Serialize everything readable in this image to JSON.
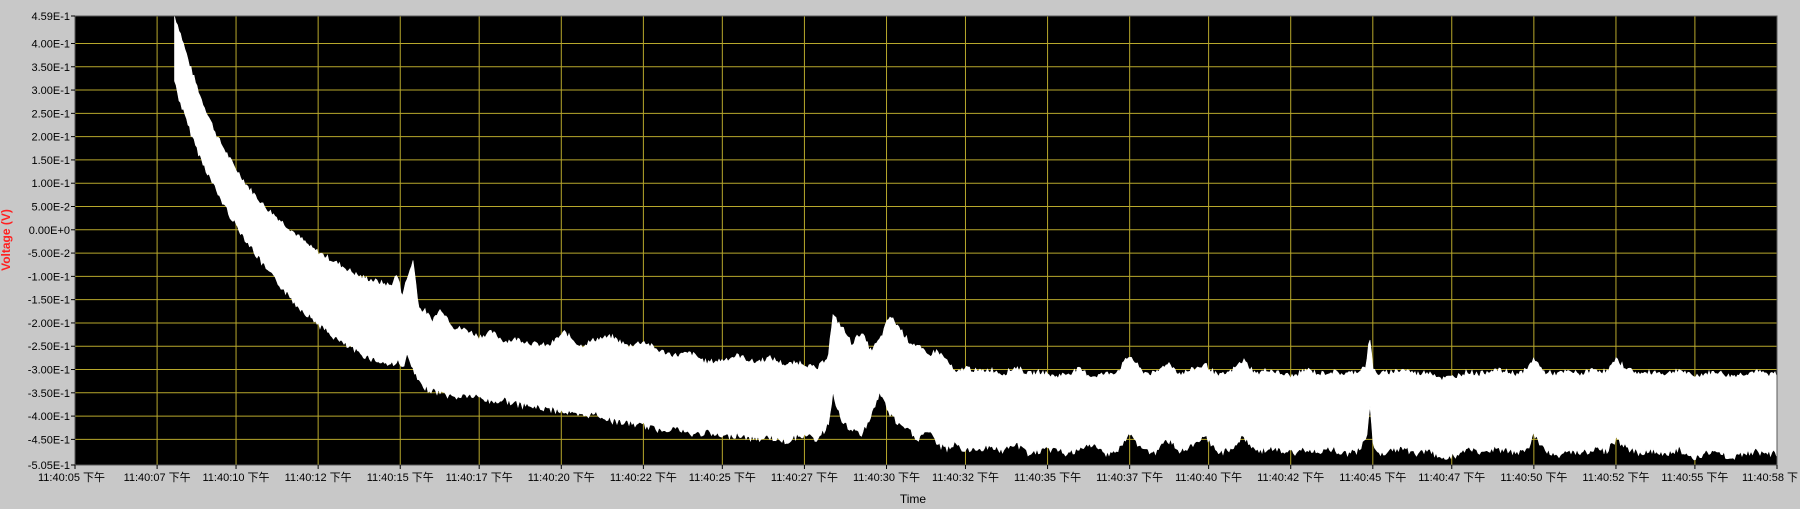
{
  "chart_data": {
    "type": "line",
    "title": "",
    "xlabel": "Time",
    "ylabel": "Voltage (V)",
    "ylim": [
      -0.505,
      0.459
    ],
    "grid": true,
    "colors": {
      "plot_bg": "#000000",
      "grid": "#b8a82c",
      "signal": "#ffffff",
      "frame_bg": "#c8c8c8",
      "ylabel": "#ff2020",
      "tick_text": "#000000"
    },
    "y_ticks": [
      {
        "value": 0.459,
        "label": "4.59E-1"
      },
      {
        "value": 0.4,
        "label": "4.00E-1"
      },
      {
        "value": 0.35,
        "label": "3.50E-1"
      },
      {
        "value": 0.3,
        "label": "3.00E-1"
      },
      {
        "value": 0.25,
        "label": "2.50E-1"
      },
      {
        "value": 0.2,
        "label": "2.00E-1"
      },
      {
        "value": 0.15,
        "label": "1.50E-1"
      },
      {
        "value": 0.1,
        "label": "1.00E-1"
      },
      {
        "value": 0.05,
        "label": "5.00E-2"
      },
      {
        "value": 0.0,
        "label": "0.00E+0"
      },
      {
        "value": -0.05,
        "label": "-5.00E-2"
      },
      {
        "value": -0.1,
        "label": "-1.00E-1"
      },
      {
        "value": -0.15,
        "label": "-1.50E-1"
      },
      {
        "value": -0.2,
        "label": "-2.00E-1"
      },
      {
        "value": -0.25,
        "label": "-2.50E-1"
      },
      {
        "value": -0.3,
        "label": "-3.00E-1"
      },
      {
        "value": -0.35,
        "label": "-3.50E-1"
      },
      {
        "value": -0.4,
        "label": "-4.00E-1"
      },
      {
        "value": -0.45,
        "label": "-4.50E-1"
      },
      {
        "value": -0.505,
        "label": "-5.05E-1"
      }
    ],
    "x_ticks": [
      {
        "t": 0.0,
        "label": "11:40:05 下午"
      },
      {
        "t": 2.6,
        "label": "11:40:07 下午"
      },
      {
        "t": 5.1,
        "label": "11:40:10 下午"
      },
      {
        "t": 7.7,
        "label": "11:40:12 下午"
      },
      {
        "t": 10.3,
        "label": "11:40:15 下午"
      },
      {
        "t": 12.8,
        "label": "11:40:17 下午"
      },
      {
        "t": 15.4,
        "label": "11:40:20 下午"
      },
      {
        "t": 18.0,
        "label": "11:40:22 下午"
      },
      {
        "t": 20.5,
        "label": "11:40:25 下午"
      },
      {
        "t": 23.1,
        "label": "11:40:27 下午"
      },
      {
        "t": 25.7,
        "label": "11:40:30 下午"
      },
      {
        "t": 28.2,
        "label": "11:40:32 下午"
      },
      {
        "t": 30.8,
        "label": "11:40:35 下午"
      },
      {
        "t": 33.4,
        "label": "11:40:37 下午"
      },
      {
        "t": 35.9,
        "label": "11:40:40 下午"
      },
      {
        "t": 38.5,
        "label": "11:40:42 下午"
      },
      {
        "t": 41.1,
        "label": "11:40:45 下午"
      },
      {
        "t": 43.6,
        "label": "11:40:47 下午"
      },
      {
        "t": 46.2,
        "label": "11:40:50 下午"
      },
      {
        "t": 48.8,
        "label": "11:40:52 下午"
      },
      {
        "t": 51.3,
        "label": "11:40:55 下午"
      },
      {
        "t": 53.9,
        "label": "11:40:58 下"
      }
    ],
    "xlim": [
      0,
      53.9
    ],
    "series": [
      {
        "kind": "band",
        "x": [
          3.15,
          3.3,
          3.6,
          4.0,
          4.5,
          5.0,
          5.5,
          6.0,
          6.5,
          7.0,
          7.5,
          8.0,
          8.5,
          9.0,
          9.5,
          10.0,
          10.2,
          10.35,
          10.5,
          10.7,
          10.9,
          11.1,
          11.3,
          11.6,
          12.0,
          12.4,
          12.8,
          13.2,
          13.6,
          14.0,
          14.5,
          15.0,
          15.5,
          16.0,
          16.5,
          17.0,
          17.5,
          18.0,
          18.5,
          19.0,
          19.5,
          20.0,
          20.5,
          21.0,
          21.5,
          22.0,
          22.5,
          23.0,
          23.5,
          23.85,
          24.0,
          24.3,
          24.6,
          24.9,
          25.2,
          25.5,
          25.8,
          26.1,
          26.4,
          26.7,
          27.0,
          27.3,
          27.6,
          27.9,
          28.2,
          28.6,
          29.0,
          29.4,
          29.8,
          30.2,
          30.6,
          31.0,
          31.4,
          31.8,
          32.2,
          32.6,
          33.0,
          33.4,
          33.8,
          34.2,
          34.6,
          35.0,
          35.4,
          35.8,
          36.2,
          36.6,
          37.0,
          37.4,
          37.8,
          38.2,
          38.6,
          39.0,
          39.4,
          39.8,
          40.2,
          40.6,
          40.9,
          41.0,
          41.1,
          41.3,
          41.7,
          42.1,
          42.5,
          42.9,
          43.3,
          43.7,
          44.1,
          44.5,
          44.9,
          45.3,
          45.7,
          46.0,
          46.2,
          46.5,
          46.9,
          47.3,
          47.7,
          48.1,
          48.5,
          48.8,
          49.2,
          49.6,
          50.0,
          50.4,
          50.8,
          51.2,
          51.6,
          52.0,
          52.4,
          52.8,
          53.2,
          53.6,
          53.9
        ],
        "upper": [
          0.459,
          0.43,
          0.36,
          0.28,
          0.2,
          0.14,
          0.09,
          0.05,
          0.02,
          -0.01,
          -0.04,
          -0.06,
          -0.08,
          -0.1,
          -0.11,
          -0.12,
          -0.095,
          -0.14,
          -0.11,
          -0.065,
          -0.17,
          -0.175,
          -0.195,
          -0.17,
          -0.21,
          -0.215,
          -0.23,
          -0.22,
          -0.24,
          -0.235,
          -0.245,
          -0.25,
          -0.22,
          -0.25,
          -0.235,
          -0.23,
          -0.25,
          -0.24,
          -0.26,
          -0.27,
          -0.265,
          -0.285,
          -0.28,
          -0.27,
          -0.285,
          -0.275,
          -0.29,
          -0.285,
          -0.3,
          -0.27,
          -0.185,
          -0.21,
          -0.245,
          -0.22,
          -0.26,
          -0.235,
          -0.185,
          -0.21,
          -0.24,
          -0.25,
          -0.27,
          -0.26,
          -0.28,
          -0.31,
          -0.295,
          -0.305,
          -0.3,
          -0.31,
          -0.295,
          -0.31,
          -0.305,
          -0.315,
          -0.31,
          -0.3,
          -0.315,
          -0.31,
          -0.305,
          -0.27,
          -0.305,
          -0.31,
          -0.285,
          -0.31,
          -0.3,
          -0.29,
          -0.315,
          -0.305,
          -0.28,
          -0.31,
          -0.3,
          -0.31,
          -0.315,
          -0.3,
          -0.31,
          -0.305,
          -0.31,
          -0.305,
          -0.29,
          -0.225,
          -0.3,
          -0.31,
          -0.305,
          -0.3,
          -0.31,
          -0.305,
          -0.32,
          -0.315,
          -0.305,
          -0.31,
          -0.3,
          -0.305,
          -0.31,
          -0.3,
          -0.275,
          -0.305,
          -0.31,
          -0.305,
          -0.31,
          -0.3,
          -0.305,
          -0.28,
          -0.3,
          -0.31,
          -0.305,
          -0.31,
          -0.3,
          -0.315,
          -0.31,
          -0.305,
          -0.315,
          -0.31,
          -0.305,
          -0.31,
          -0.31
        ],
        "lower": [
          0.32,
          0.28,
          0.22,
          0.15,
          0.08,
          0.02,
          -0.03,
          -0.08,
          -0.12,
          -0.16,
          -0.19,
          -0.22,
          -0.245,
          -0.265,
          -0.28,
          -0.29,
          -0.28,
          -0.3,
          -0.27,
          -0.3,
          -0.33,
          -0.34,
          -0.345,
          -0.35,
          -0.36,
          -0.355,
          -0.36,
          -0.37,
          -0.365,
          -0.375,
          -0.38,
          -0.385,
          -0.39,
          -0.4,
          -0.395,
          -0.41,
          -0.415,
          -0.42,
          -0.43,
          -0.425,
          -0.44,
          -0.435,
          -0.445,
          -0.44,
          -0.45,
          -0.445,
          -0.455,
          -0.44,
          -0.45,
          -0.42,
          -0.35,
          -0.415,
          -0.43,
          -0.44,
          -0.4,
          -0.35,
          -0.395,
          -0.42,
          -0.43,
          -0.45,
          -0.43,
          -0.46,
          -0.47,
          -0.46,
          -0.475,
          -0.47,
          -0.465,
          -0.475,
          -0.46,
          -0.48,
          -0.475,
          -0.47,
          -0.48,
          -0.475,
          -0.46,
          -0.48,
          -0.475,
          -0.44,
          -0.47,
          -0.48,
          -0.45,
          -0.475,
          -0.465,
          -0.445,
          -0.48,
          -0.47,
          -0.445,
          -0.475,
          -0.47,
          -0.475,
          -0.48,
          -0.47,
          -0.475,
          -0.47,
          -0.48,
          -0.475,
          -0.45,
          -0.37,
          -0.46,
          -0.48,
          -0.475,
          -0.47,
          -0.48,
          -0.475,
          -0.49,
          -0.485,
          -0.47,
          -0.48,
          -0.47,
          -0.475,
          -0.48,
          -0.47,
          -0.44,
          -0.47,
          -0.485,
          -0.475,
          -0.48,
          -0.47,
          -0.475,
          -0.45,
          -0.47,
          -0.48,
          -0.475,
          -0.48,
          -0.47,
          -0.49,
          -0.48,
          -0.475,
          -0.49,
          -0.48,
          -0.475,
          -0.48,
          -0.48
        ]
      }
    ]
  }
}
